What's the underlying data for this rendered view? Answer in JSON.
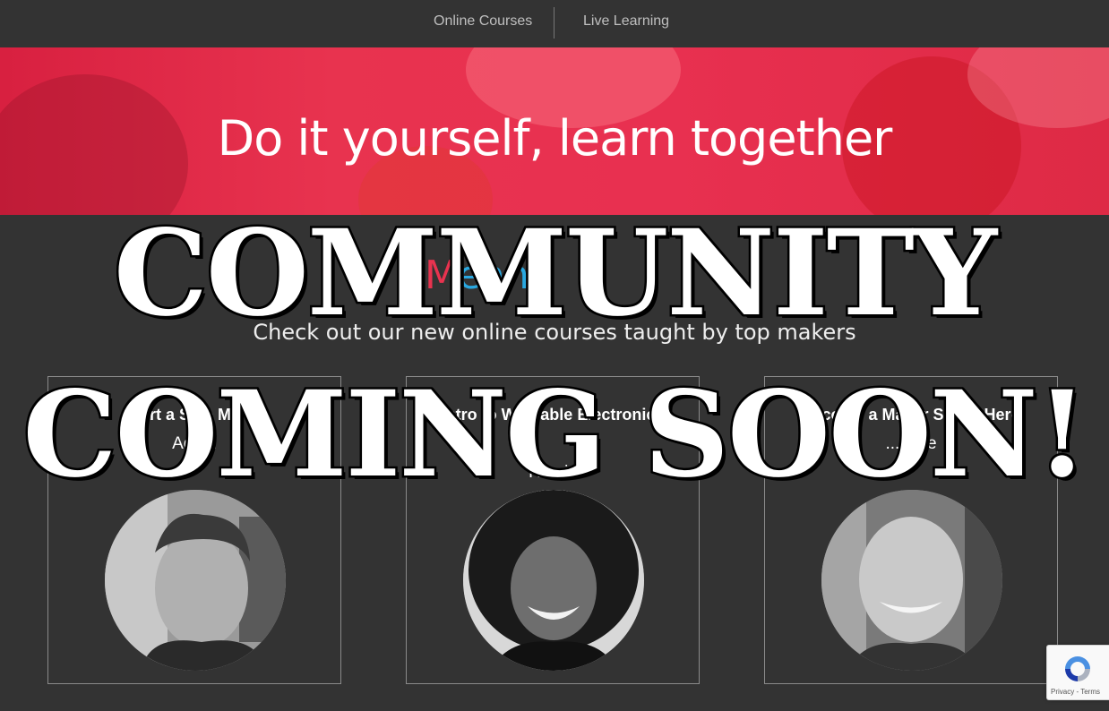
{
  "nav": {
    "items": [
      {
        "label": "Online Courses"
      },
      {
        "label": "Live Learning"
      }
    ]
  },
  "hero": {
    "title": "Do it yourself, learn together"
  },
  "logo": {
    "part1": "M",
    "part2": "ean"
  },
  "tagline": "Check out our new online courses taught by top makers",
  "courses": [
    {
      "title": "Start a Side Maker",
      "author": "Adam"
    },
    {
      "title": "Intro to Wearable Electronics",
      "author": "Ro...is"
    },
    {
      "title": "Become a Maker Super-Hero",
      "author": "...ouse"
    }
  ],
  "overlay": {
    "line1": "COMMUNITY",
    "line2": "COMING SOON!"
  },
  "recaptcha": {
    "privacy": "Privacy",
    "separator": " - ",
    "terms": "Terms"
  }
}
